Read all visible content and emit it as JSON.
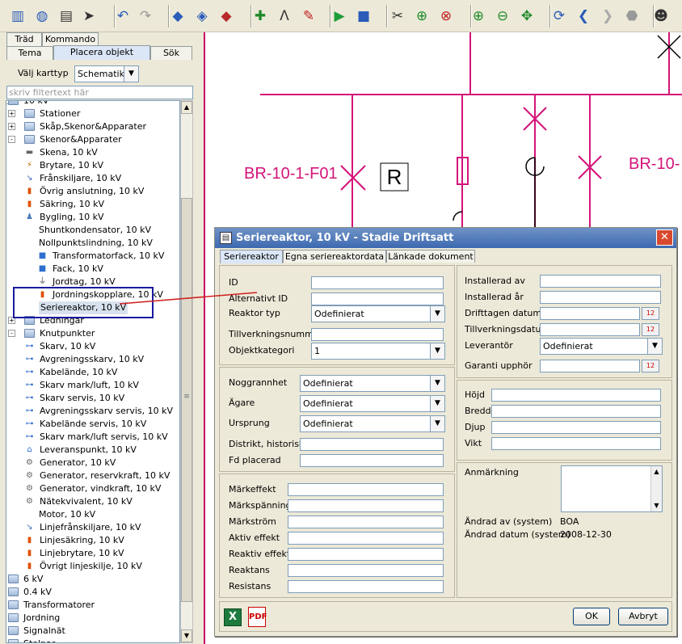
{
  "toolbar": {
    "icons": [
      "layout-icon",
      "globe-gear-icon",
      "report-icon",
      "pointer-icon",
      "undo-icon",
      "redo-icon",
      "blue-cubes-icon",
      "cubes-arrow-icon",
      "cubes-red-icon",
      "node-add-icon",
      "line-a-icon",
      "pen-icon",
      "green-cube-icon",
      "blue-cube-icon",
      "unlink-icon",
      "link-add-icon",
      "link-delete-icon",
      "zoom-in-icon",
      "zoom-out-icon",
      "pan-icon",
      "refresh-icon",
      "back-icon",
      "forward-icon",
      "stop-icon",
      "user-icon"
    ]
  },
  "left": {
    "tabs_row1": [
      "Träd",
      "Kommando"
    ],
    "tabs_row2": [
      "Tema",
      "Placera objekt",
      "Sök"
    ],
    "karttyp_label": "Välj karttyp",
    "karttyp_value": "Schematik",
    "filter_placeholder": "skriv filtertext här",
    "tree": [
      {
        "label": "10 kV",
        "indent": 0,
        "icon": "folder",
        "exp": "-"
      },
      {
        "label": "Stationer",
        "indent": 1,
        "icon": "folder",
        "exp": "+"
      },
      {
        "label": "Skåp,Skenor&Apparater",
        "indent": 1,
        "icon": "folder",
        "exp": "+"
      },
      {
        "label": "Skenor&Apparater",
        "indent": 1,
        "icon": "folder",
        "exp": "-"
      },
      {
        "label": "Skena, 10 kV",
        "indent": 2,
        "icon": "busbar"
      },
      {
        "label": "Brytare, 10 kV",
        "indent": 2,
        "icon": "breaker"
      },
      {
        "label": "Frånskiljare, 10 kV",
        "indent": 2,
        "icon": "disconnector"
      },
      {
        "label": "Övrig anslutning, 10 kV",
        "indent": 2,
        "icon": "connection"
      },
      {
        "label": "Säkring, 10 kV",
        "indent": 2,
        "icon": "fuse"
      },
      {
        "label": "Bygling, 10 kV",
        "indent": 2,
        "icon": "jumper"
      },
      {
        "label": "Shuntkondensator, 10 kV",
        "indent": 2,
        "icon": "none"
      },
      {
        "label": "Nollpunktslindning, 10 kV",
        "indent": 2,
        "icon": "none"
      },
      {
        "label": "Transformatorfack, 10 kV",
        "indent": 3,
        "icon": "bay"
      },
      {
        "label": "Fack, 10 kV",
        "indent": 3,
        "icon": "bay"
      },
      {
        "label": "Jordtag, 10 kV",
        "indent": 3,
        "icon": "earth"
      },
      {
        "label": "Jordningskopplare, 10 kV",
        "indent": 3,
        "icon": "connection"
      },
      {
        "label": "Seriereaktor, 10 kV",
        "indent": 2,
        "icon": "none",
        "selected": true
      },
      {
        "label": "Ledningar",
        "indent": 1,
        "icon": "folder",
        "exp": "+"
      },
      {
        "label": "Knutpunkter",
        "indent": 1,
        "icon": "folder",
        "exp": "-"
      },
      {
        "label": "Skarv, 10 kV",
        "indent": 2,
        "icon": "joint"
      },
      {
        "label": "Avgreningsskarv, 10 kV",
        "indent": 2,
        "icon": "joint"
      },
      {
        "label": "Kabelände, 10 kV",
        "indent": 2,
        "icon": "joint"
      },
      {
        "label": "Skarv mark/luft, 10 kV",
        "indent": 2,
        "icon": "joint"
      },
      {
        "label": "Skarv servis, 10 kV",
        "indent": 2,
        "icon": "joint"
      },
      {
        "label": "Avgreningsskarv servis, 10 kV",
        "indent": 2,
        "icon": "joint"
      },
      {
        "label": "Kabelände servis, 10 kV",
        "indent": 2,
        "icon": "joint"
      },
      {
        "label": "Skarv mark/luft servis, 10 kV",
        "indent": 2,
        "icon": "joint"
      },
      {
        "label": "Leveranspunkt, 10 kV",
        "indent": 2,
        "icon": "delivery"
      },
      {
        "label": "Generator, 10 kV",
        "indent": 2,
        "icon": "generator"
      },
      {
        "label": "Generator, reservkraft, 10 kV",
        "indent": 2,
        "icon": "generator"
      },
      {
        "label": "Generator, vindkraft, 10 kV",
        "indent": 2,
        "icon": "generator"
      },
      {
        "label": "Nätekvivalent, 10 kV",
        "indent": 2,
        "icon": "generator"
      },
      {
        "label": "Motor, 10 kV",
        "indent": 2,
        "icon": "none"
      },
      {
        "label": "Linjefrånskiljare, 10 kV",
        "indent": 2,
        "icon": "disconnector"
      },
      {
        "label": "Linjesäkring, 10 kV",
        "indent": 2,
        "icon": "fuse"
      },
      {
        "label": "Linjebrytare, 10 kV",
        "indent": 2,
        "icon": "connection"
      },
      {
        "label": "Övrigt linjeskilje, 10 kV",
        "indent": 2,
        "icon": "connection"
      },
      {
        "label": "6 kV",
        "indent": 0,
        "icon": "folder"
      },
      {
        "label": "0.4 kV",
        "indent": 0,
        "icon": "folder"
      },
      {
        "label": "Transformatorer",
        "indent": 0,
        "icon": "folder"
      },
      {
        "label": "Jordning",
        "indent": 0,
        "icon": "folder"
      },
      {
        "label": "Signalnät",
        "indent": 0,
        "icon": "folder"
      },
      {
        "label": "Stolpar",
        "indent": 0,
        "icon": "folder"
      }
    ]
  },
  "map": {
    "labels": [
      "BR-10-1-F01",
      "BR-10-",
      "R"
    ]
  },
  "dialog": {
    "title": "Seriereaktor, 10 kV - Stadie Driftsatt",
    "tabs": [
      "Seriereaktor",
      "Egna seriereaktordata",
      "Länkade dokument"
    ],
    "fields": {
      "id": {
        "label": "ID",
        "value": ""
      },
      "alt_id": {
        "label": "Alternativt ID",
        "value": ""
      },
      "reaktor_typ": {
        "label": "Reaktor typ",
        "value": "Odefinierat"
      },
      "tillverkningsnummer": {
        "label": "Tillverkningsnummer",
        "value": ""
      },
      "objektkategori": {
        "label": "Objektkategori",
        "value": "1"
      },
      "noggrannhet": {
        "label": "Noggrannhet",
        "value": "Odefinierat"
      },
      "agare": {
        "label": "Ägare",
        "value": "Odefinierat"
      },
      "ursprung": {
        "label": "Ursprung",
        "value": "Odefinierat"
      },
      "distrikt": {
        "label": "Distrikt, historiskt",
        "value": ""
      },
      "fd_placerad": {
        "label": "Fd placerad",
        "value": ""
      },
      "markeffekt": {
        "label": "Märkeffekt",
        "value": ""
      },
      "markspanning": {
        "label": "Märkspänning",
        "value": ""
      },
      "markstrom": {
        "label": "Märkström",
        "value": ""
      },
      "aktiv_effekt": {
        "label": "Aktiv effekt",
        "value": ""
      },
      "reaktiv_effekt": {
        "label": "Reaktiv effekt",
        "value": ""
      },
      "reaktans": {
        "label": "Reaktans",
        "value": ""
      },
      "resistans": {
        "label": "Resistans",
        "value": ""
      },
      "installerad_av": {
        "label": "Installerad av",
        "value": ""
      },
      "installerad_ar": {
        "label": "Installerad år",
        "value": ""
      },
      "drifttagen_datum": {
        "label": "Drifttagen datum",
        "value": ""
      },
      "tillverkningsdatum": {
        "label": "Tillverkningsdatum",
        "value": ""
      },
      "leverantor": {
        "label": "Leverantör",
        "value": "Odefinierat"
      },
      "garanti_upphor": {
        "label": "Garanti upphör",
        "value": ""
      },
      "hojd": {
        "label": "Höjd",
        "value": ""
      },
      "bredd": {
        "label": "Bredd",
        "value": ""
      },
      "djup": {
        "label": "Djup",
        "value": ""
      },
      "vikt": {
        "label": "Vikt",
        "value": ""
      },
      "anmarkning": {
        "label": "Anmärkning",
        "value": ""
      },
      "andrad_av": {
        "label": "Ändrad av (system)",
        "value": "BOA"
      },
      "andrad_datum": {
        "label": "Ändrad datum (system)",
        "value": "2008-12-30"
      }
    },
    "ok_label": "OK",
    "cancel_label": "Avbryt",
    "calendar_icon_text": "12"
  }
}
